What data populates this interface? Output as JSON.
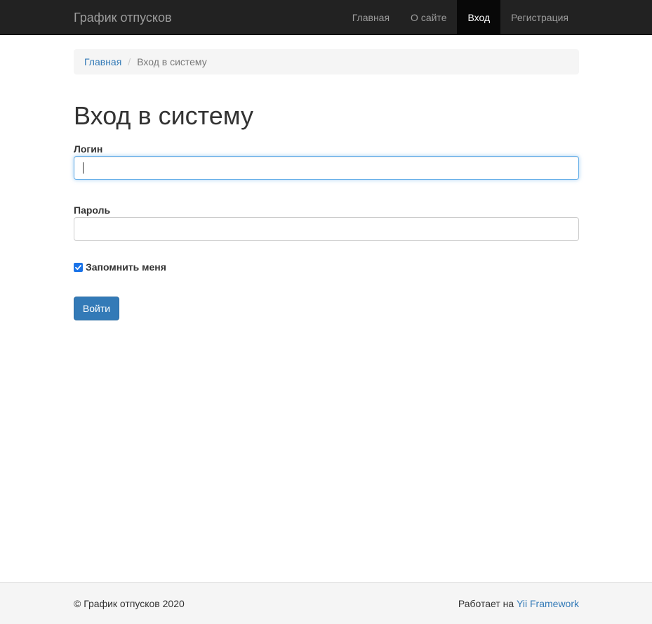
{
  "navbar": {
    "brand": "График отпусков",
    "items": [
      {
        "label": "Главная",
        "active": false
      },
      {
        "label": "О сайте",
        "active": false
      },
      {
        "label": "Вход",
        "active": true
      },
      {
        "label": "Регистрация",
        "active": false
      }
    ]
  },
  "breadcrumb": {
    "home": "Главная",
    "separator": "/",
    "current": "Вход в систему"
  },
  "page": {
    "title": "Вход в систему"
  },
  "form": {
    "login_label": "Логин",
    "login_value": "",
    "password_label": "Пароль",
    "password_value": "",
    "remember_label": "Запомнить меня",
    "remember_checked": true,
    "submit_label": "Войти"
  },
  "footer": {
    "copyright": "© График отпусков 2020",
    "powered_prefix": "Работает на ",
    "powered_link": "Yii Framework"
  },
  "colors": {
    "navbar_bg": "#222222",
    "nav_active_bg": "#080808",
    "link": "#337ab7",
    "primary_button": "#337ab7",
    "checkbox": "#1a73e8"
  }
}
